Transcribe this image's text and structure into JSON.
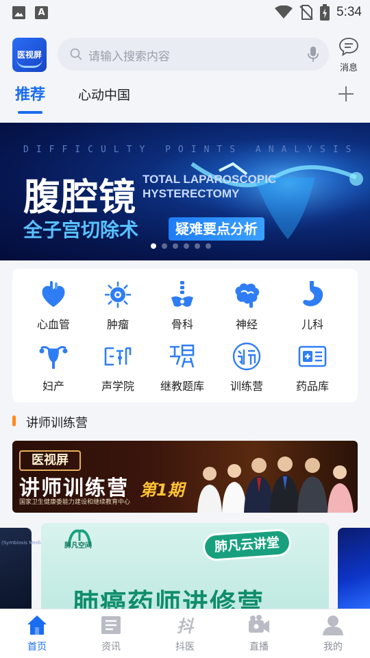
{
  "status_bar": {
    "time": "5:34",
    "icons": [
      "image-icon",
      "a-icon",
      "wifi-icon",
      "no-sim-icon",
      "battery-icon"
    ]
  },
  "header": {
    "logo_text": "医视屏",
    "search_placeholder": "请输入搜索内容",
    "message_label": "消息"
  },
  "tabs": [
    {
      "label": "推荐",
      "active": true
    },
    {
      "label": "心动中国",
      "active": false
    }
  ],
  "banner": {
    "top_text": "DIFFICULTY POINTS ANALYSIS",
    "title": "腹腔镜",
    "en_text": "TOTAL LAPAROSCOPIC HYSTERECTOMY",
    "subtitle": "全子宫切除术",
    "tag": "疑难要点分析",
    "pages": 6,
    "current_page": 1
  },
  "categories": [
    {
      "label": "心血管",
      "icon": "heart-icon"
    },
    {
      "label": "肿瘤",
      "icon": "tumor-cell-icon"
    },
    {
      "label": "骨科",
      "icon": "spine-icon"
    },
    {
      "label": "神经",
      "icon": "brain-icon"
    },
    {
      "label": "儿科",
      "icon": "stomach-icon"
    },
    {
      "label": "妇产",
      "icon": "uterus-icon"
    },
    {
      "label": "声学院",
      "icon": "ultrasound-icon"
    },
    {
      "label": "继教题库",
      "icon": "question-bank-icon"
    },
    {
      "label": "训练营",
      "icon": "lecturer-icon"
    },
    {
      "label": "药品库",
      "icon": "medicine-box-icon"
    }
  ],
  "section": {
    "title": "讲师训练营"
  },
  "camp_banner": {
    "brand": "医视屏",
    "title": "讲师训练营",
    "episode": "第1期",
    "org": "国家卫生健康委能力建设和继续教育中心"
  },
  "lower": {
    "left_card_text": "(Symbiosis Media)",
    "logo_text": "肺凡空间",
    "badge": "肺凡云讲堂",
    "big_title": "肺癌药师进修营"
  },
  "nav": [
    {
      "label": "首页",
      "icon": "home-icon",
      "active": true
    },
    {
      "label": "资讯",
      "icon": "news-icon",
      "active": false
    },
    {
      "label": "抖医",
      "icon": "douyi-icon",
      "active": false
    },
    {
      "label": "直播",
      "icon": "live-camera-icon",
      "active": false
    },
    {
      "label": "我的",
      "icon": "profile-icon",
      "active": false
    }
  ],
  "colors": {
    "accent": "#1a6cf0",
    "section_bar": "#ff8a1e",
    "icon_blue": "#2f7df4"
  }
}
